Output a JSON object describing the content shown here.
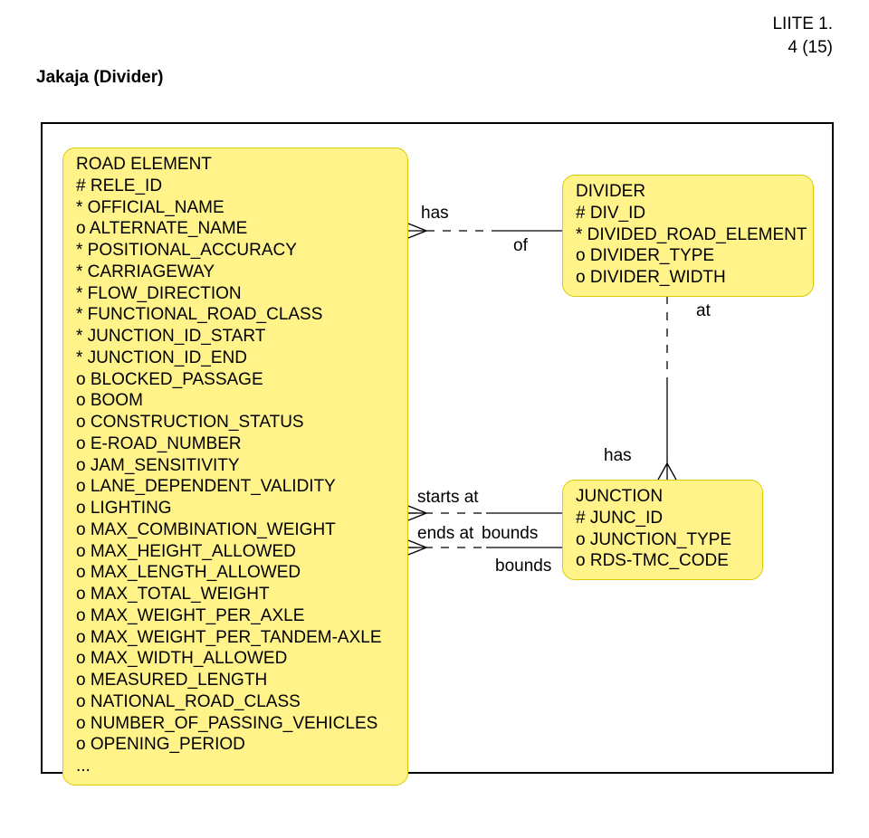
{
  "header": {
    "line1": "LIITE 1.",
    "line2": "4 (15)"
  },
  "section_title": "Jakaja (Divider)",
  "labels": {
    "has1": "has",
    "of": "of",
    "at": "at",
    "has2": "has",
    "starts_at": "starts at",
    "ends_at": "ends at",
    "bounds1": "bounds",
    "bounds2": "bounds"
  },
  "entities": {
    "road_element": {
      "title": "ROAD ELEMENT",
      "attrs": [
        "# RELE_ID",
        "* OFFICIAL_NAME",
        "o ALTERNATE_NAME",
        "* POSITIONAL_ACCURACY",
        "* CARRIAGEWAY",
        "* FLOW_DIRECTION",
        "* FUNCTIONAL_ROAD_CLASS",
        "* JUNCTION_ID_START",
        "* JUNCTION_ID_END",
        "o BLOCKED_PASSAGE",
        "o BOOM",
        "o CONSTRUCTION_STATUS",
        "o E-ROAD_NUMBER",
        "o JAM_SENSITIVITY",
        "o LANE_DEPENDENT_VALIDITY",
        "o LIGHTING",
        "o MAX_COMBINATION_WEIGHT",
        "o MAX_HEIGHT_ALLOWED",
        "o MAX_LENGTH_ALLOWED",
        "o MAX_TOTAL_WEIGHT",
        "o MAX_WEIGHT_PER_AXLE",
        "o MAX_WEIGHT_PER_TANDEM-AXLE",
        "o MAX_WIDTH_ALLOWED",
        "o MEASURED_LENGTH",
        "o NATIONAL_ROAD_CLASS",
        "o NUMBER_OF_PASSING_VEHICLES",
        "o OPENING_PERIOD"
      ],
      "ellipsis": "..."
    },
    "divider": {
      "title": "DIVIDER",
      "attrs": [
        "# DIV_ID",
        "* DIVIDED_ROAD_ELEMENT",
        "o DIVIDER_TYPE",
        "o DIVIDER_WIDTH"
      ]
    },
    "junction": {
      "title": "JUNCTION",
      "attrs": [
        "# JUNC_ID",
        "o JUNCTION_TYPE",
        "o RDS-TMC_CODE"
      ]
    }
  }
}
